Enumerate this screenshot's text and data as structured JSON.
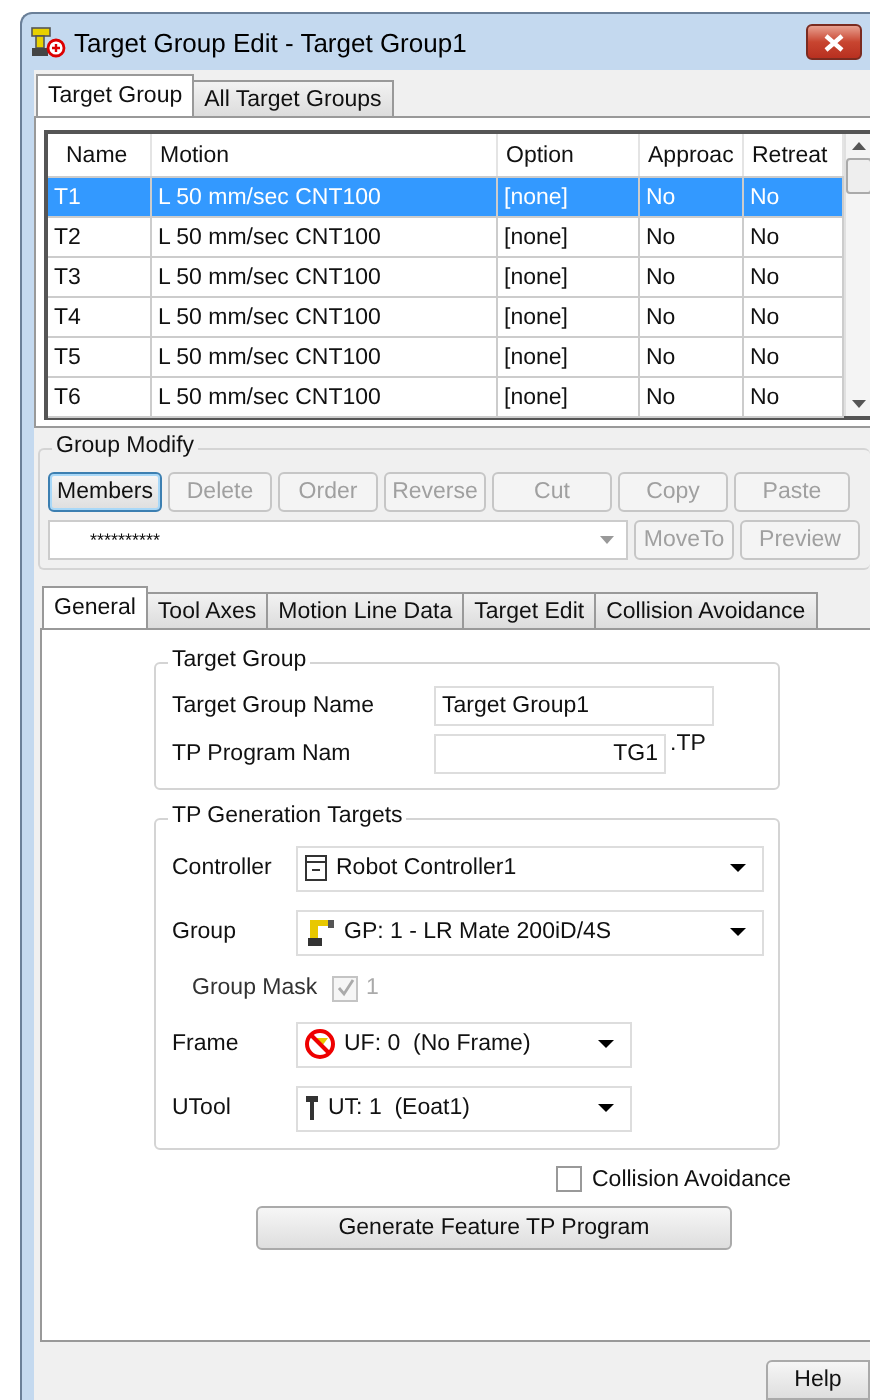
{
  "window": {
    "title": "Target Group Edit - Target Group1"
  },
  "tabs": [
    {
      "label": "Target Group",
      "selected": true
    },
    {
      "label": "All Target Groups",
      "selected": false
    }
  ],
  "table": {
    "columns": [
      "Name",
      "Motion",
      "Option",
      "Approac",
      "Retreat"
    ],
    "rows": [
      {
        "cells": [
          "T1",
          "L 50 mm/sec CNT100",
          "[none]",
          "No",
          "No"
        ],
        "selected": true
      },
      {
        "cells": [
          "T2",
          "L 50 mm/sec CNT100",
          "[none]",
          "No",
          "No"
        ],
        "selected": false
      },
      {
        "cells": [
          "T3",
          "L 50 mm/sec CNT100",
          "[none]",
          "No",
          "No"
        ],
        "selected": false
      },
      {
        "cells": [
          "T4",
          "L 50 mm/sec CNT100",
          "[none]",
          "No",
          "No"
        ],
        "selected": false
      },
      {
        "cells": [
          "T5",
          "L 50 mm/sec CNT100",
          "[none]",
          "No",
          "No"
        ],
        "selected": false
      },
      {
        "cells": [
          "T6",
          "L 50 mm/sec CNT100",
          "[none]",
          "No",
          "No"
        ],
        "selected": false
      }
    ]
  },
  "group_modify": {
    "title": "Group Modify",
    "buttons": [
      {
        "label": "Members",
        "disabled": false
      },
      {
        "label": "Delete",
        "disabled": true
      },
      {
        "label": "Order",
        "disabled": true
      },
      {
        "label": "Reverse",
        "disabled": true
      },
      {
        "label": "Cut",
        "disabled": true
      },
      {
        "label": "Copy",
        "disabled": true
      },
      {
        "label": "Paste",
        "disabled": true
      }
    ],
    "dropdown": {
      "value": "**********"
    },
    "buttons_2": [
      {
        "label": "MoveTo",
        "disabled": true
      },
      {
        "label": "Preview",
        "disabled": true
      }
    ]
  },
  "detail_tabs": [
    {
      "label": "General",
      "selected": true
    },
    {
      "label": "Tool Axes",
      "selected": false
    },
    {
      "label": "Motion Line Data",
      "selected": false
    },
    {
      "label": "Target Edit",
      "selected": false
    },
    {
      "label": "Collision Avoidance",
      "selected": false
    }
  ],
  "target_group": {
    "title": "Target Group",
    "name_label": "Target Group Name",
    "name_value": "Target Group1",
    "program_label": "TP Program Nam",
    "program_value": "TG1",
    "program_suffix": ".TP"
  },
  "tp_generation": {
    "title": "TP Generation Targets",
    "rows": [
      {
        "kind": "select",
        "label": "Controller",
        "value": "Robot Controller1"
      },
      {
        "kind": "select",
        "label": "Group",
        "value": "GP: 1 - LR Mate 200iD/4S"
      },
      {
        "kind": "checkbox",
        "label": "Group Mask",
        "text": "1",
        "checked": true,
        "disabled": true
      },
      {
        "kind": "select",
        "label": "Frame",
        "value": "UF: 0  (No Frame)"
      },
      {
        "kind": "select",
        "label": "UTool",
        "value": "UT: 1  (Eoat1)"
      }
    ]
  },
  "collision_avoidance": {
    "label": "Collision Avoidance",
    "checked": false
  },
  "generate_button": "Generate Feature TP Program",
  "help_button": "Help"
}
